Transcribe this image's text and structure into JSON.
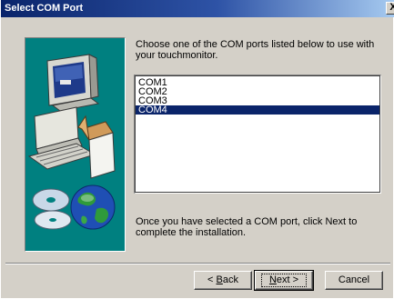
{
  "window": {
    "title": "Select COM Port",
    "close_glyph": "X"
  },
  "content": {
    "instruction": "Choose one of the COM ports listed below to use with your touchmonitor.",
    "ports": [
      "COM1",
      "COM2",
      "COM3",
      "COM4"
    ],
    "selected_port": "COM4",
    "completion_note": "Once you have selected a COM port, click Next to complete the installation."
  },
  "buttons": {
    "back_prefix": "< ",
    "back_mnemonic": "B",
    "back_rest": "ack",
    "next_mnemonic": "N",
    "next_rest": "ext >",
    "cancel": "Cancel"
  },
  "colors": {
    "title_start": "#0a246a",
    "title_end": "#a6caf0",
    "selection": "#0a246a",
    "panel_bg": "#008080",
    "face": "#d4d0c8"
  },
  "illustration": {
    "icons": [
      "computer-icon",
      "cd-disc-icon",
      "globe-icon"
    ]
  }
}
